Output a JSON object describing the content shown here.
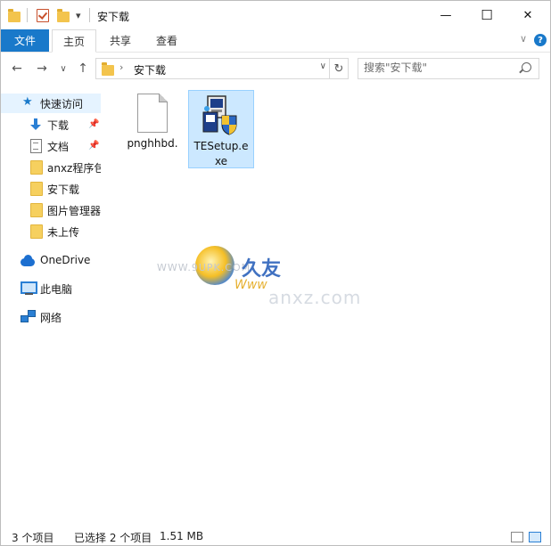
{
  "window": {
    "title": "安下载",
    "controls": {
      "minimize": "—",
      "maximize": "☐",
      "close": "✕"
    }
  },
  "quick_access_toolbar": {
    "dropdown_glyph": "▾"
  },
  "ribbon": {
    "tabs": [
      {
        "label": "文件",
        "active": false,
        "highlight": true
      },
      {
        "label": "主页",
        "active": true
      },
      {
        "label": "共享",
        "active": false
      },
      {
        "label": "查看",
        "active": false
      }
    ],
    "expand_glyph": "∨",
    "help_glyph": "?"
  },
  "navigation": {
    "back_glyph": "←",
    "forward_glyph": "→",
    "recent_glyph": "∨",
    "up_glyph": "↑",
    "path_separator": "›",
    "path": "安下载",
    "dropdown_glyph": "∨",
    "refresh_glyph": "↻"
  },
  "search": {
    "placeholder": "搜索\"安下载\""
  },
  "sidebar": {
    "items": [
      {
        "label": "快速访问",
        "icon": "star-icon",
        "selected": true
      },
      {
        "label": "下载",
        "icon": "download-arrow-icon",
        "pinned": true
      },
      {
        "label": "文档",
        "icon": "document-icon",
        "pinned": true
      },
      {
        "label": "anxz程序包",
        "icon": "folder-icon"
      },
      {
        "label": "安下载",
        "icon": "folder-icon"
      },
      {
        "label": "图片管理器",
        "icon": "folder-icon"
      },
      {
        "label": "未上传",
        "icon": "folder-icon"
      },
      {
        "label": "OneDrive",
        "icon": "onedrive-cloud-icon"
      },
      {
        "label": "此电脑",
        "icon": "computer-icon"
      },
      {
        "label": "网络",
        "icon": "network-icon"
      }
    ],
    "pin_glyph": "📌"
  },
  "files": [
    {
      "name": "pnghhbd.",
      "icon": "blank-file-icon",
      "selected": false
    },
    {
      "name": "TESetup.exe",
      "icon": "setup-installer-icon",
      "selected": true
    }
  ],
  "watermark": {
    "brand": "久友",
    "www": "Www",
    "domain": "anxz.com",
    "url": "WWW.9UPK.COM"
  },
  "status_bar": {
    "item_count": "3 个项目",
    "selection": "已选择 2 个项目",
    "size": "1.51 MB"
  },
  "colors": {
    "accent": "#1979ca",
    "selection_bg": "#cce8ff",
    "selection_border": "#99d1ff",
    "folder": "#f3c44d"
  }
}
